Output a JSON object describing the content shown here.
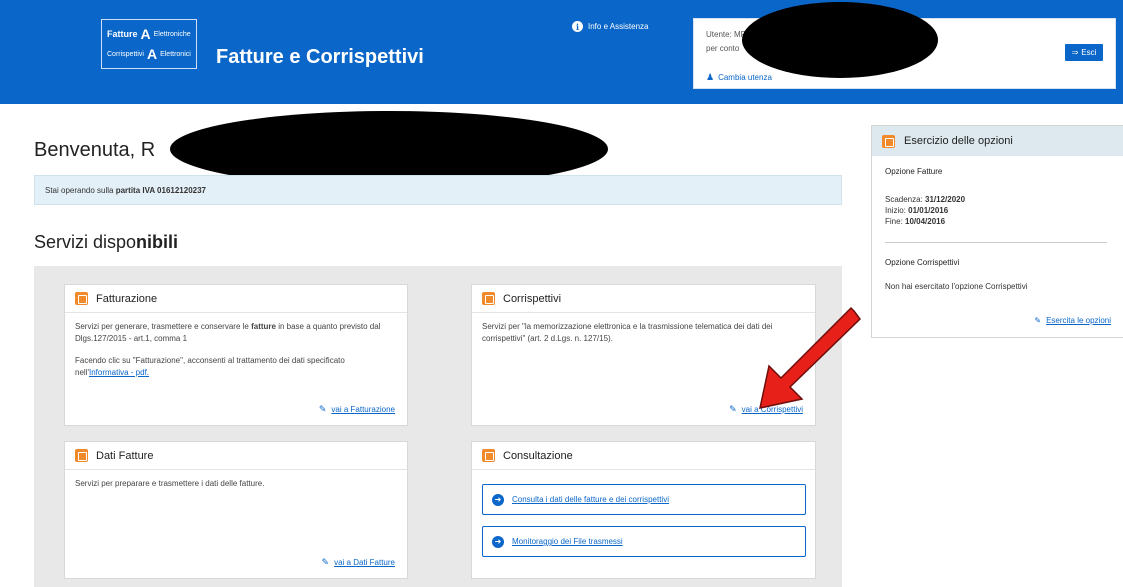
{
  "header": {
    "logo": {
      "line1": "Fatture",
      "line1b": "Elettroniche",
      "line2": "Corrispettivi",
      "line2b": "Elettronici"
    },
    "app_title": "Fatture e Corrispettivi",
    "info_link": "Info e Assistenza",
    "user_box": {
      "line1": "Utente: MR",
      "line2": "per conto",
      "change_user": "Cambia utenza",
      "exit_label": "Esci"
    }
  },
  "main": {
    "welcome": "Benvenuta, R",
    "partita_prefix": "Stai operando sulla ",
    "partita_bold": "partita IVA 01612120237",
    "services_title_a": "Servizi dispo",
    "services_title_b": "nibili",
    "cards": [
      {
        "title": "Fatturazione",
        "text1_a": "Servizi per generare, trasmettere e conservare le ",
        "text1_bold": "fatture",
        "text1_b": " in base a quanto previsto dal Dlgs.127/2015 - art.1, comma 1",
        "text2_a": "Facendo clic su \"Fatturazione\", acconsenti al trattamento dei dati specificato nell'",
        "text2_link": "Informativa - pdf.",
        "link": "vai a Fatturazione"
      },
      {
        "title": "Corrispettivi",
        "text1": "Servizi per \"la memorizzazione elettronica e la trasmissione telematica dei dati dei corrispettivi\" (art. 2 d.Lgs. n. 127/15).",
        "link": "vai a Corrispettivi"
      },
      {
        "title": "Dati Fatture",
        "text1": "Servizi per preparare e trasmettere i dati delle fatture.",
        "link": "vai a Dati Fatture"
      },
      {
        "title": "Consultazione",
        "button1": "Consulta i dati delle fatture e dei corrispettivi",
        "button2": "Monitoraggio dei File trasmessi"
      }
    ]
  },
  "side_panel": {
    "title": "Esercizio delle opzioni",
    "opt_fatture_title": "Opzione Fatture",
    "scadenza_label": "Scadenza: ",
    "scadenza_value": "31/12/2020",
    "inizio_label": "Inizio: ",
    "inizio_value": "01/01/2016",
    "fine_label": "Fine: ",
    "fine_value": "10/04/2016",
    "opt_corr_title": "Opzione Corrispettivi",
    "opt_corr_text": "Non hai esercitato l'opzione Corrispettivi",
    "link": "Esercita le opzioni"
  },
  "colors": {
    "brand_blue": "#0a66c8",
    "orange_icon": "#f08a2a",
    "info_bg": "#e4f0f7",
    "arrow_red": "#e8201a"
  },
  "icons": [
    "info-icon",
    "users-icon",
    "exit-icon",
    "card-b-icon",
    "edit-icon",
    "arrow-right-circle-icon",
    "red-pointer-arrow"
  ]
}
